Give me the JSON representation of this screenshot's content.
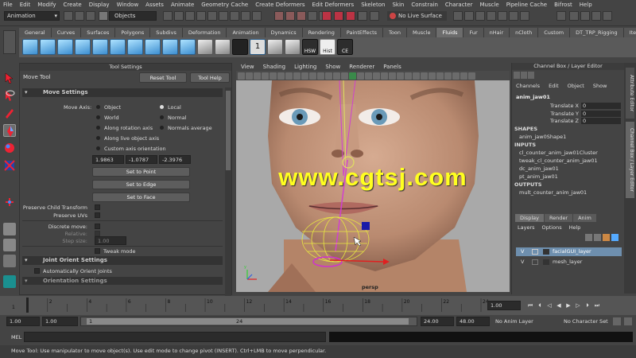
{
  "menubar": [
    "File",
    "Edit",
    "Modify",
    "Create",
    "Display",
    "Window",
    "Assets",
    "Animate",
    "Geometry Cache",
    "Create Deformers",
    "Edit Deformers",
    "Skeleton",
    "Skin",
    "Constrain",
    "Character",
    "Muscle",
    "Pipeline Cache",
    "Bifrost",
    "Help"
  ],
  "statusline": {
    "mode": "Animation",
    "objects_label": "Objects",
    "live_surface": "No Live Surface"
  },
  "shelf": {
    "tabs": [
      "General",
      "Curves",
      "Surfaces",
      "Polygons",
      "Subdivs",
      "Deformation",
      "Animation",
      "Dynamics",
      "Rendering",
      "PaintEffects",
      "Toon",
      "Muscle",
      "Fluids",
      "Fur",
      "nHair",
      "nCloth",
      "Custom",
      "DT_TRP_Rigging",
      "Item"
    ],
    "active": "Fluids",
    "text_icons": [
      "HSW",
      "Hist",
      "CE"
    ],
    "number_icon": "1"
  },
  "tool_settings": {
    "panel_title": "Tool Settings",
    "tool_name": "Move Tool",
    "reset_button": "Reset Tool",
    "help_button": "Tool Help",
    "move_settings_header": "Move Settings",
    "move_axis_label": "Move Axis:",
    "axis_options": [
      "Object",
      "World",
      "Along rotation axis",
      "Along live object axis",
      "Custom axis orientation"
    ],
    "axis_options_right": [
      "Local",
      "Normal",
      "Normals average"
    ],
    "custom_values": [
      "1.9863",
      "-1.0787",
      "-2.3976"
    ],
    "set_to_point": "Set to Point",
    "set_to_edge": "Set to Edge",
    "set_to_face": "Set to Face",
    "preserve_child": "Preserve Child Transform",
    "preserve_uvs": "Preserve UVs",
    "discrete_move": "Discrete move:",
    "relative": "Relative:",
    "step_size": "Step size:",
    "step_value": "1.00",
    "tweak_mode": "Tweak mode",
    "joint_orient_header": "Joint Orient Settings",
    "auto_orient": "Automatically Orient Joints",
    "orientation_header": "Orientation Settings"
  },
  "viewport": {
    "menu": [
      "View",
      "Shading",
      "Lighting",
      "Show",
      "Renderer",
      "Panels"
    ],
    "camera": "persp",
    "watermark": "www.cgtsj.com"
  },
  "channel_box": {
    "title": "Channel Box / Layer Editor",
    "menu": [
      "Channels",
      "Edit",
      "Object",
      "Show"
    ],
    "object": "anim_jaw01",
    "attributes": [
      {
        "name": "Translate X",
        "value": "0"
      },
      {
        "name": "Translate Y",
        "value": "0"
      },
      {
        "name": "Translate Z",
        "value": "0"
      }
    ],
    "shapes_header": "SHAPES",
    "shapes": [
      "anim_jaw0Shape1"
    ],
    "inputs_header": "INPUTS",
    "inputs": [
      "cl_counter_anim_jaw01Cluster",
      "tweak_cl_counter_anim_jaw01",
      "dc_anim_jaw01",
      "pt_anim_jaw01"
    ],
    "outputs_header": "OUTPUTS",
    "outputs": [
      "mult_counter_anim_jaw01"
    ]
  },
  "side_tabs": [
    "Attribute Editor",
    "Channel Box / Layer Editor"
  ],
  "layer_editor": {
    "tabs": [
      "Display",
      "Render",
      "Anim"
    ],
    "menu": [
      "Layers",
      "Options",
      "Help"
    ],
    "layers": [
      {
        "v": "V",
        "name": "facialGUI_layer"
      },
      {
        "v": "V",
        "name": "mesh_layer"
      }
    ]
  },
  "timeline": {
    "ticks": [
      "1",
      "2",
      "4",
      "6",
      "8",
      "10",
      "12",
      "14",
      "16",
      "18",
      "20",
      "22",
      "24"
    ],
    "current_frame": "1.00"
  },
  "range": {
    "start": "1.00",
    "inner_start": "1.00",
    "slider_start": "1",
    "slider_end": "24",
    "inner_end": "24.00",
    "end": "48.00",
    "anim_layer": "No Anim Layer",
    "character_set": "No Character Set"
  },
  "command": {
    "label": "MEL"
  },
  "help_line": "Move Tool: Use manipulator to move object(s). Use edit mode to change pivot (INSERT). Ctrl+LMB to move perpendicular."
}
